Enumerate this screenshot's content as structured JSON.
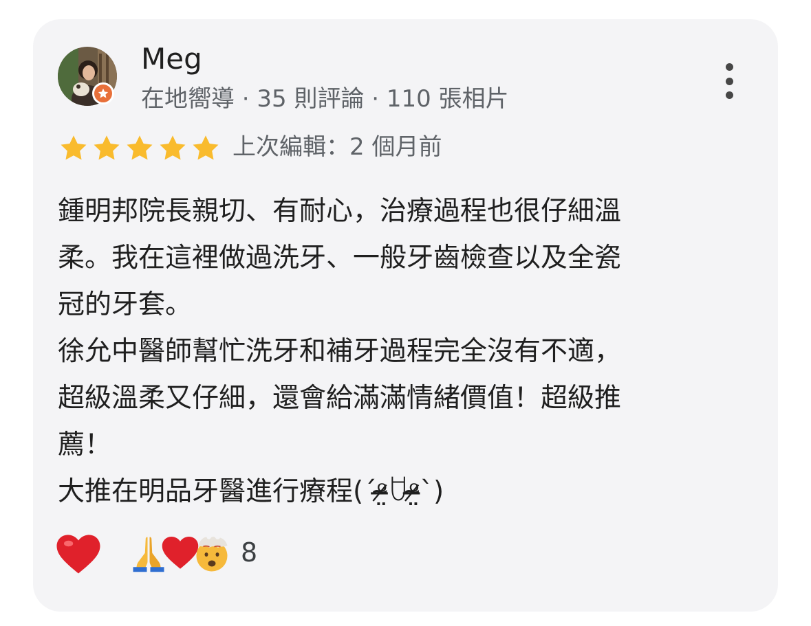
{
  "reviewer": {
    "name": "Meg",
    "meta": "在地嚮導 · 35 則評論 · 110 張相片",
    "badge_icon": "local-guide-star-icon"
  },
  "rating": {
    "stars": 5,
    "max": 5,
    "color": "#f9bb2d",
    "edited": "上次編輯：2 個月前"
  },
  "review_lines": [
    "鍾明邦院長親切、有耐心，治療過程也很仔細溫",
    "柔。我在這裡做過洗牙、一般牙齒檢查以及全瓷",
    "冠的牙套。",
    "徐允中醫師幫忙洗牙和補牙過程完全沒有不適，",
    "超級溫柔又仔細，還會給滿滿情緒價值！超級推",
    "薦！",
    "大推在明品牙醫進行療程(ˊᵒ̴̶̷̤ꇴᵒ̴̶̷̤ˋ)"
  ],
  "reactions": {
    "like_icon": "red-heart-icon",
    "summary_icons": [
      "folded-hands-icon",
      "red-heart-icon",
      "exploding-head-icon"
    ],
    "count": "8"
  },
  "colors": {
    "card_bg": "#f4f4f6",
    "badge": "#e8703a",
    "text": "#1f1f1f",
    "muted": "#5f6368"
  }
}
